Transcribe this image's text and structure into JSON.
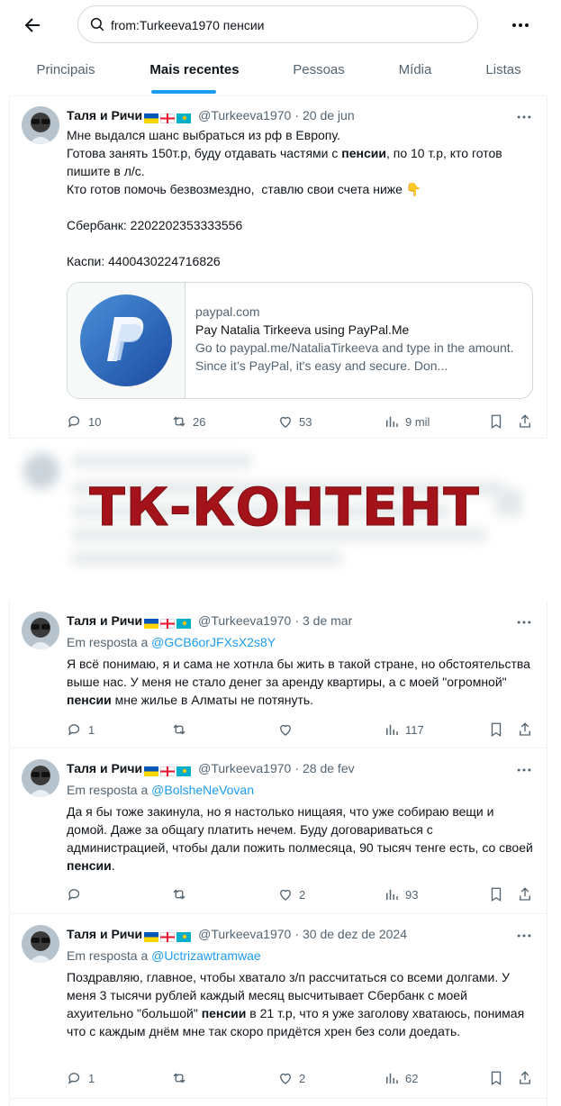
{
  "search": {
    "query": "from:Turkeeva1970 пенсии"
  },
  "tabs": [
    {
      "label": "Principais"
    },
    {
      "label": "Mais recentes"
    },
    {
      "label": "Pessoas"
    },
    {
      "label": "Mídia"
    },
    {
      "label": "Listas"
    }
  ],
  "tweets": [
    {
      "name": "Таля и Ричи",
      "handle": "@Turkeeva1970",
      "date": "20 de jun",
      "text_html": "Мне выдался шанс выбраться из рф в Европу.\nГотова занять 150т.р, буду отдавать частями с <b>пенсии</b>, по 10 т.р, кто готов пишите в л/с.\nКто готов помочь безвозмездно,  ставлю свои счета ниже 👇\n\nСбербанк: 2202202353333556\n\nКаспи: 4400430224716826",
      "card": {
        "domain": "paypal.com",
        "title": "Pay Natalia Tirkeeva using PayPal.Me",
        "description": "Go to paypal.me/NataliaTirkeeva and type in the amount. Since it’s PayPal, it's easy and secure. Don..."
      },
      "replies": "10",
      "retweets": "26",
      "likes": "53",
      "views": "9 mil"
    },
    {
      "name": "Таля и Ричи",
      "handle": "@Turkeeva1970",
      "date": "3 de mar",
      "reply_prefix": "Em resposta a",
      "reply_to": "@GCB6orJFXsX2s8Y",
      "text_html": "Я всё понимаю, я и сама не хотнла бы жить в такой стране, но обстоятельства выше нас. У меня не стало денег за аренду квартиры, а с моей \"огромной\" <b>пенсии</b> мне жилье в Алматы не потянуть.",
      "replies": "1",
      "retweets": "",
      "likes": "",
      "views": "117"
    },
    {
      "name": "Таля и Ричи",
      "handle": "@Turkeeva1970",
      "date": "28 de fev",
      "reply_prefix": "Em resposta a",
      "reply_to": "@BolsheNeVovan",
      "text_html": "Да я бы тоже закинула, но я настолько нищаяя, что уже собираю вещи и домой. Даже за общагу платить нечем. Буду договариваться с администрацией, чтобы дали пожить полмесяца, 90 тысяч тенге есть, со своей <b>пенсии</b>.",
      "replies": "",
      "retweets": "",
      "likes": "2",
      "views": "93"
    },
    {
      "name": "Таля и Ричи",
      "handle": "@Turkeeva1970",
      "date": "30 de dez de 2024",
      "reply_prefix": "Em resposta a",
      "reply_to": "@Uctrizawtramwae",
      "text_html": "Поздравляю, главное, чтобы хватало з/п рассчитаться со всеми долгами. У меня 3 тысячи рублей каждый месяц высчитывает Сбербанк с моей ахуительно \"большой\" <b>пенсии</b> в 21 т.р, что я уже заголову хватаюсь, понимая что с каждым днём мне так скоро придётся хрен без соли доедать.",
      "replies": "1",
      "retweets": "",
      "likes": "2",
      "views": "62"
    }
  ],
  "watermark": "ТК-КОНТЕНТ",
  "colors": {
    "accent": "#1d9bf0",
    "text": "#0f1419",
    "muted": "#536471",
    "watermark": "#a4131a"
  }
}
